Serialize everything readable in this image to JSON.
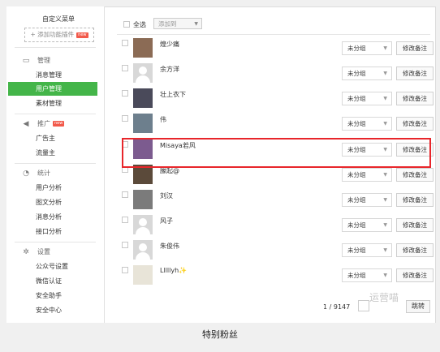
{
  "sidebar": {
    "custom_menu": "自定义菜单",
    "add_plugin": "+ 添加功能插件",
    "add_plugin_badge": "new",
    "sections": [
      {
        "title": "管理",
        "icon": "monitor-icon",
        "items": [
          "消息管理",
          "用户管理",
          "素材管理"
        ],
        "active": "用户管理"
      },
      {
        "title": "推广",
        "icon": "megaphone-icon",
        "badge": "new",
        "items": [
          "广告主",
          "流量主"
        ]
      },
      {
        "title": "统计",
        "icon": "pie-chart-icon",
        "items": [
          "用户分析",
          "图文分析",
          "消息分析",
          "接口分析"
        ]
      },
      {
        "title": "设置",
        "icon": "gear-icon",
        "items": [
          "公众号设置",
          "微信认证",
          "安全助手",
          "安全中心"
        ]
      }
    ]
  },
  "toolbar": {
    "select_all": "全选",
    "add_to_placeholder": "添加到"
  },
  "users": [
    {
      "name": "煌少痛",
      "group": "未分组",
      "action": "修改备注"
    },
    {
      "name": "余方洋",
      "group": "未分组",
      "action": "修改备注"
    },
    {
      "name": "壮上衣下",
      "group": "未分组",
      "action": "修改备注"
    },
    {
      "name": "伟",
      "group": "未分组",
      "action": "修改备注"
    },
    {
      "name": "Misaya若风",
      "group": "未分组",
      "action": "修改备注"
    },
    {
      "name": "朦起@",
      "group": "未分组",
      "action": "修改备注"
    },
    {
      "name": "刘汉",
      "group": "未分组",
      "action": "修改备注"
    },
    {
      "name": "风子",
      "group": "未分组",
      "action": "修改备注"
    },
    {
      "name": "朱俊伟",
      "group": "未分组",
      "action": "修改备注"
    },
    {
      "name": "Lllllyh✨",
      "group": "未分组",
      "action": "修改备注"
    }
  ],
  "pagination": {
    "page_text": "1 / 9147",
    "jump_label": "跳转"
  },
  "watermark": "运营喵",
  "caption": "特别粉丝",
  "colors": {
    "accent": "#44b549",
    "highlight": "#e8262b",
    "badge": "#f25a4b"
  }
}
